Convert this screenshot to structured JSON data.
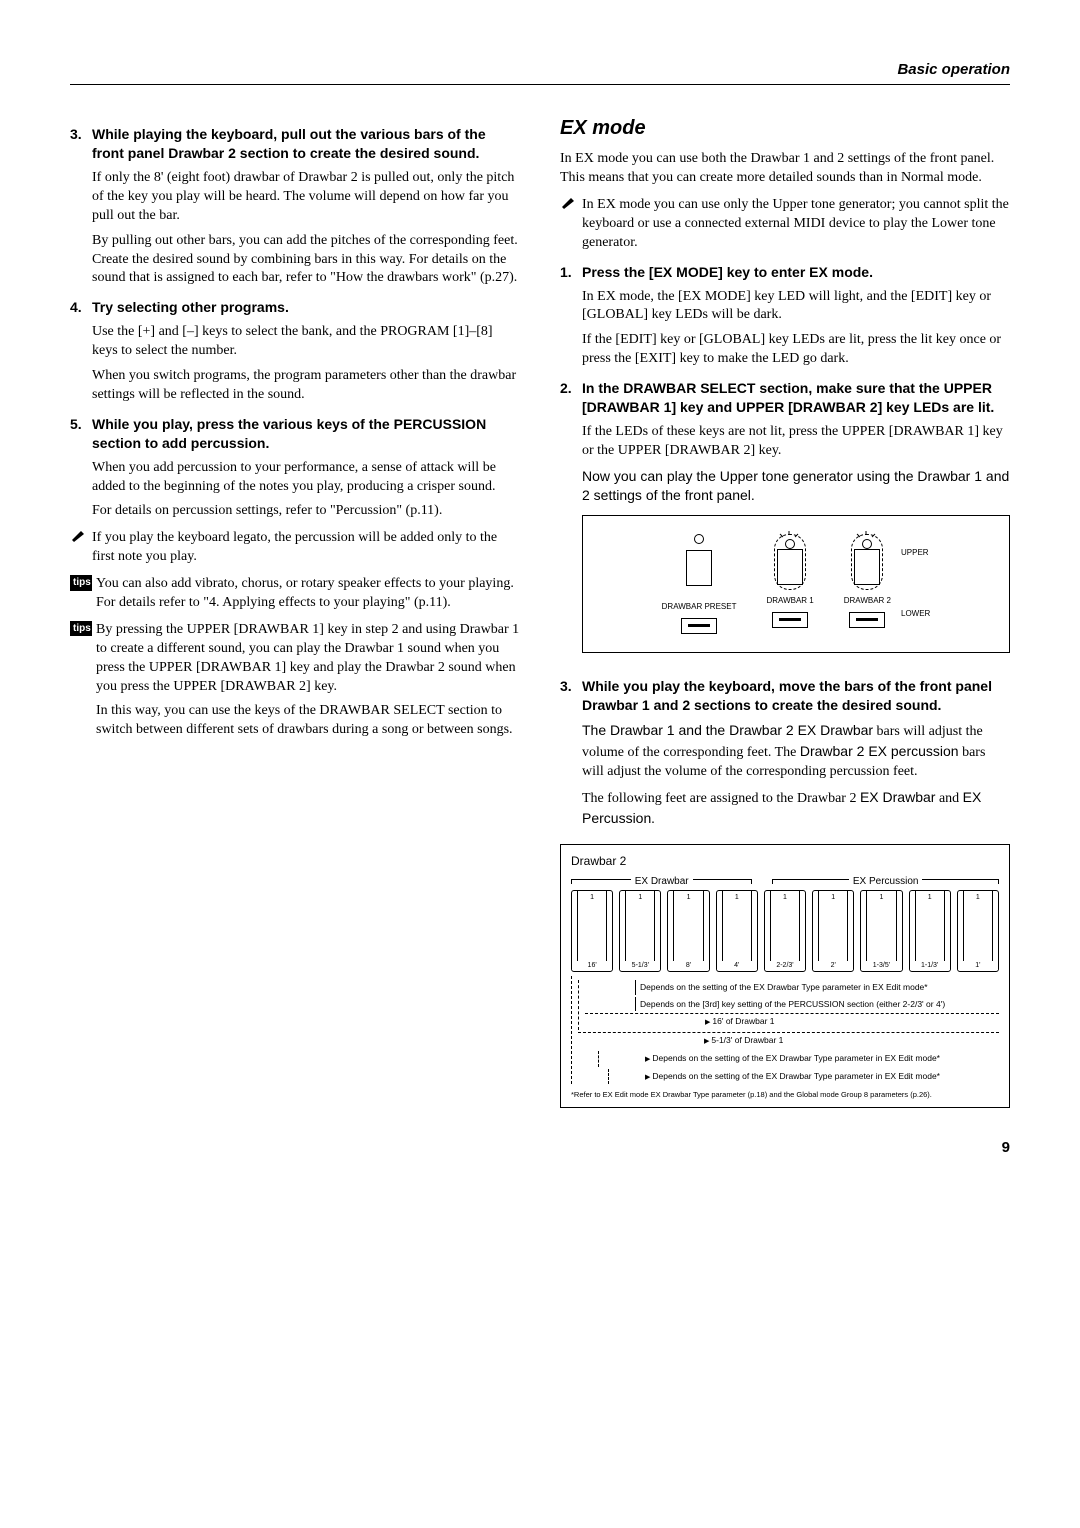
{
  "header": {
    "section_title": "Basic operation"
  },
  "left": {
    "s3": {
      "num": "3.",
      "head": "While playing the keyboard, pull out the various bars of the front panel Drawbar 2 section to create the desired sound.",
      "p1": "If only the 8' (eight foot) drawbar of Drawbar 2   is pulled out, only the pitch of the key you play will be heard. The volume will depend on how far you pull out the bar.",
      "p2": "By pulling out other bars, you can add the pitches of the corresponding feet. Create the desired sound by combining bars in this way. For details on the sound that is assigned to each bar, refer to \"How the drawbars work\" (p.27)."
    },
    "s4": {
      "num": "4.",
      "head": "Try selecting other programs.",
      "p1": "Use the [+] and [–] keys to select the bank, and the PROGRAM [1]–[8] keys to select the number.",
      "p2": "When you switch programs, the program parameters other than the drawbar settings will be reflected in the sound."
    },
    "s5": {
      "num": "5.",
      "head": "While you play, press the various keys of the PERCUSSION section to add percussion.",
      "p1": "When you add percussion to your performance, a sense of attack will be added to the beginning of the notes you play, producing a crisper sound.",
      "p2": "For details on percussion settings, refer to \"Percussion\" (p.11)."
    },
    "note1": "If you play the keyboard legato, the percussion will be added only to the first note you play.",
    "tip1": "You can also add vibrato, chorus, or rotary speaker effects to your playing. For details refer to \"4. Applying effects to your playing\" (p.11).",
    "tip2": "By pressing the UPPER [DRAWBAR 1] key in step 2 and using Drawbar 1 to create a different sound, you can play the Drawbar 1 sound when you press the UPPER [DRAWBAR 1] key and play the Drawbar 2 sound when you press the UPPER [DRAWBAR 2] key.",
    "tip2b": "In this way, you can use the keys of the DRAWBAR SELECT section to switch between different sets of drawbars during a song or between songs."
  },
  "right": {
    "title": "EX mode",
    "intro": "In EX mode you can use both the Drawbar 1 and 2 settings of the front panel. This means that you can create more detailed sounds than in Normal mode.",
    "note": "In EX mode you can use only the Upper tone generator; you cannot split the keyboard or use a connected external MIDI device to play the Lower tone generator.",
    "s1": {
      "num": "1.",
      "head": "Press the [EX MODE] key to enter EX mode.",
      "p1": "In EX mode, the [EX MODE] key LED will light, and the [EDIT] key or [GLOBAL] key LEDs will be dark.",
      "p2": "If the [EDIT] key or [GLOBAL] key LEDs are lit, press the lit key once or press the [EXIT] key to make the LED go dark."
    },
    "s2": {
      "num": "2.",
      "head": "In the DRAWBAR SELECT section, make sure that the UPPER [DRAWBAR 1] key and UPPER [DRAWBAR 2] key LEDs are lit.",
      "p1": "If the LEDs of these keys are not lit, press the UPPER [DRAWBAR 1] key or the UPPER [DRAWBAR 2] key.",
      "p2": "Now you can play the Upper tone generator using the Drawbar 1 and 2 settings of the front panel."
    },
    "dsel": {
      "c1": "DRAWBAR PRESET",
      "c2": "DRAWBAR 1",
      "c3": "DRAWBAR 2",
      "upper": "UPPER",
      "lower": "LOWER"
    },
    "s3": {
      "num": "3.",
      "head": "While you play the keyboard, move the bars of the front panel Drawbar 1 and 2 sections to create the desired sound.",
      "p1a": "The ",
      "p1b": "Drawbar 1",
      "p1c": " and the ",
      "p1d": "Drawbar 2 EX Drawbar",
      "p1e": " bars will adjust the volume of the corresponding feet. The ",
      "p1f": "Drawbar 2 EX percussion",
      "p1g": " bars will adjust the volume of the corresponding percussion feet.",
      "p2a": "The following feet are assigned to the Drawbar 2 ",
      "p2b": "EX Drawbar",
      "p2c": " and ",
      "p2d": "EX Percussion",
      "p2e": "."
    },
    "db2": {
      "title": "Drawbar 2",
      "ex_drawbar": "EX Drawbar",
      "ex_percussion": "EX Percussion",
      "feet": [
        "16'",
        "5-1/3'",
        "8'",
        "4'",
        "2-2/3'",
        "2'",
        "1-3/5'",
        "1-1/3'",
        "1'"
      ],
      "one": "1",
      "a1": "Depends on the setting of the EX Drawbar Type parameter in EX Edit mode*",
      "a2": "Depends on the [3rd] key setting of the PERCUSSION section (either 2-2/3' or 4')",
      "a3": "16' of Drawbar 1",
      "a4": "5-1/3' of Drawbar 1",
      "a5": "Depends on the setting of the EX Drawbar Type parameter in EX Edit mode*",
      "a6": "Depends on the setting of the EX Drawbar Type parameter in EX Edit mode*",
      "foot": "*Refer to EX Edit mode EX Drawbar Type parameter (p.18) and the Global mode Group 8 parameters (p.26)."
    }
  },
  "page": "9"
}
